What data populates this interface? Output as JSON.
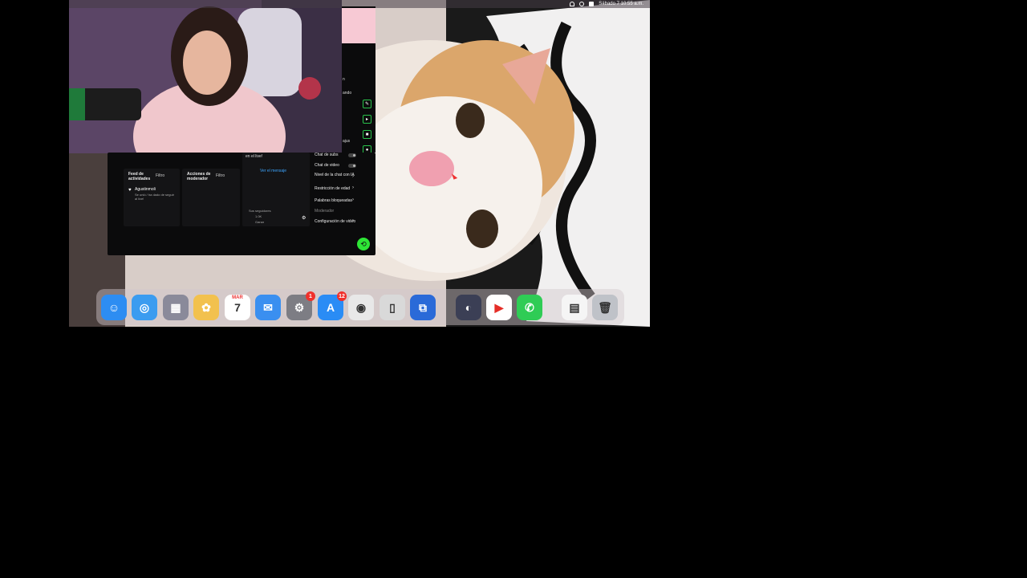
{
  "menubar": {
    "clock": "Sábado 7  10:55 a.m."
  },
  "studio": {
    "panels": {
      "activity_feed": {
        "title": "Feed de actividades",
        "filter": "Filtro"
      },
      "mod_actions": {
        "title": "Acciones de moderador",
        "filter": "Filtro"
      }
    },
    "feed_item": {
      "name": "Agustinmoli",
      "text": "Se unió / ha dado de seguir al live!"
    },
    "chat": {
      "header": "en el live!",
      "link": "Ver el mensaje",
      "viewers_label": "Sus seguidores",
      "viewer_count": "1.0K",
      "viewer_sub": "Ganar"
    },
    "settings": [
      {
        "label": "Chat de subs",
        "control": "toggle"
      },
      {
        "label": "Chat de video",
        "control": "toggle"
      },
      {
        "label": "Nivel de la chat con IA",
        "control": "chevron"
      },
      {
        "label": "Restricción de edad",
        "control": "chevron"
      },
      {
        "label": "Palabras bloqueadas",
        "control": "chevron"
      },
      {
        "label": "Moderador",
        "control": "none"
      },
      {
        "label": "Configuración de video",
        "control": "chevron"
      }
    ],
    "side_labels": {
      "label_1": "n",
      "label_2": "ando",
      "label_3": "ajus"
    }
  },
  "dock": {
    "apps": [
      {
        "name": "Finder",
        "glyph": "☺",
        "color": "#2d8df2"
      },
      {
        "name": "Safari",
        "glyph": "◎",
        "color": "#3b9cf0"
      },
      {
        "name": "Launchpad",
        "glyph": "▦",
        "color": "#8a8a9a"
      },
      {
        "name": "Photos",
        "glyph": "✿",
        "color": "#f2c14e"
      },
      {
        "name": "Calendar",
        "glyph": "7",
        "color": "#ffffff",
        "month": "MAR"
      },
      {
        "name": "Mail",
        "glyph": "✉",
        "color": "#3a8ff0"
      },
      {
        "name": "System Settings",
        "glyph": "⚙",
        "color": "#7d7d84",
        "badge": "1"
      },
      {
        "name": "App Store",
        "glyph": "A",
        "color": "#2a8cf5",
        "badge": "12"
      },
      {
        "name": "Chrome",
        "glyph": "◉",
        "color": "#e8e8e8"
      },
      {
        "name": "Mirroring",
        "glyph": "▯",
        "color": "#d9d9d9"
      },
      {
        "name": "Screen Share",
        "glyph": "⧉",
        "color": "#2a6ad8"
      },
      {
        "name": "OBS",
        "glyph": "◐",
        "color": "#3b3f55"
      },
      {
        "name": "YouTube",
        "glyph": "▶",
        "color": "#ffffff"
      },
      {
        "name": "WhatsApp",
        "glyph": "✆",
        "color": "#2fcc55"
      },
      {
        "name": "Document",
        "glyph": "▤",
        "color": "#f5f5f5"
      },
      {
        "name": "Trash",
        "glyph": "🗑",
        "color": "#bfc2c8"
      }
    ]
  }
}
